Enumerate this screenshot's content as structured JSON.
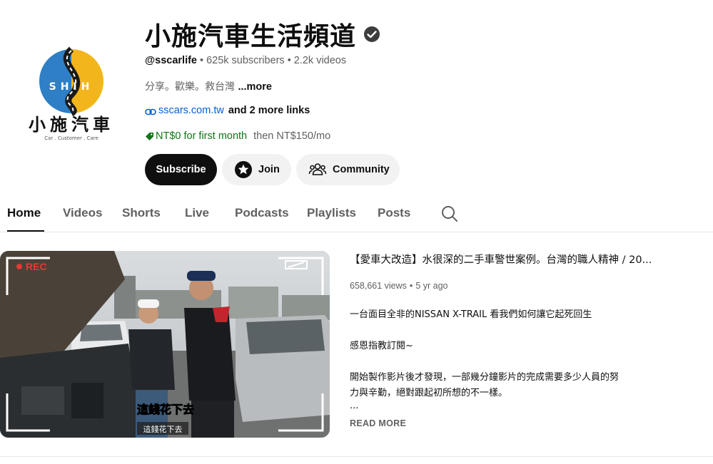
{
  "channel": {
    "title": "小施汽車生活頻道",
    "handle": "@sscarlife",
    "subscribers": "625k subscribers",
    "videos": "2.2k videos",
    "description": "分享。歡樂。救台灣",
    "description_more": "...more",
    "link_url": "sscars.com.tw",
    "more_links": "and 2 more links",
    "offer": "NT$0 for first month",
    "offer_then": "then NT$150/mo",
    "logo": {
      "big_text": "小施汽車",
      "letters": "SHIH",
      "tagline": "Car . Customer . Care"
    }
  },
  "buttons": {
    "subscribe": "Subscribe",
    "join": "Join",
    "community": "Community"
  },
  "tabs": [
    "Home",
    "Videos",
    "Shorts",
    "Live",
    "Podcasts",
    "Playlists",
    "Posts"
  ],
  "featured": {
    "title": "【愛車大改造】水很深的二手車警世案例。台灣的職人精神 / 20...",
    "views": "658,661 views",
    "age": "5 yr ago",
    "desc_lines": [
      "一台面目全非的NISSAN X-TRAIL 看我們如何讓它起死回生",
      "",
      "感恩指教訂閱~",
      "",
      "開始製作影片後才發現，一部幾分鐘影片的完成需要多少人員的努",
      "力與辛勤，絕對跟起初所想的不一樣。",
      "..."
    ],
    "read_more": "READ MORE",
    "thumbnail": {
      "rec_label": "REC",
      "caption_main": "這錢花下去",
      "caption_sub": "這錢花下去"
    }
  },
  "colors": {
    "logo_blue": "#2e7fc6",
    "logo_yellow": "#f2b61c",
    "link_blue": "#065fd4",
    "offer_green": "#107516",
    "rec_red": "#e53935"
  }
}
